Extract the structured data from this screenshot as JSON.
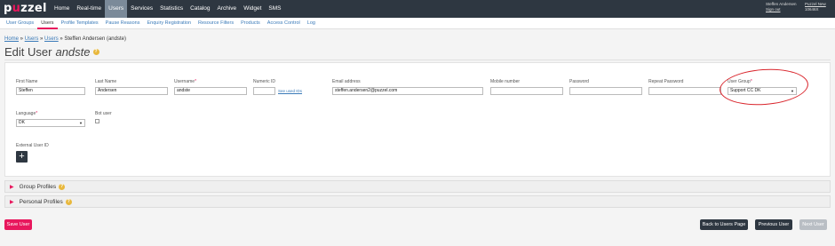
{
  "brand": {
    "logo": "puzzel"
  },
  "nav": [
    "Home",
    "Real-time",
    "Users",
    "Services",
    "Statistics",
    "Catalog",
    "Archive",
    "Widget",
    "SMS"
  ],
  "user_info": {
    "name": "Steffen Andersen",
    "sign_out": "Sign out",
    "company": "Puzzel New",
    "customer_id": "10646X"
  },
  "subnav": [
    "User Groups",
    "Users",
    "Profile Templates",
    "Pause Reasons",
    "Enquiry Registration",
    "Resource Filters",
    "Products",
    "Access Control",
    "Log"
  ],
  "breadcrumb": {
    "home": "Home",
    "users1": "Users",
    "users2": "Users",
    "current": "Steffen Andersen (andste)"
  },
  "title": {
    "prefix": "Edit User",
    "username": "andste"
  },
  "form": {
    "first_name": {
      "label": "First Name",
      "value": "Steffen"
    },
    "last_name": {
      "label": "Last Name",
      "value": "Andersen"
    },
    "username": {
      "label": "Username",
      "value": "andste"
    },
    "numeric_id": {
      "label": "Numeric ID",
      "value": "",
      "link": "See used IDs"
    },
    "email": {
      "label": "Email address",
      "value": "steffen.andersen2@puzzel.com"
    },
    "mobile": {
      "label": "Mobile number",
      "value": ""
    },
    "password": {
      "label": "Password",
      "value": ""
    },
    "repeat_password": {
      "label": "Repeat Password",
      "value": ""
    },
    "user_group": {
      "label": "User Group",
      "value": "Support CC DK"
    },
    "language": {
      "label": "Language",
      "value": "DK"
    },
    "bot_user": {
      "label": "Bot user"
    },
    "external_user_id": {
      "label": "External User ID"
    },
    "required_mark": "*",
    "add_symbol": "+"
  },
  "sections": {
    "group_profiles": "Group Profiles",
    "personal_profiles": "Personal Profiles"
  },
  "buttons": {
    "save": "Save User",
    "back": "Back to Users Page",
    "previous": "Previous User",
    "next": "Next User"
  },
  "colors": {
    "accent": "#e8175d",
    "dark": "#2e3741",
    "link": "#3a7ab8",
    "annotation": "#d9232a"
  }
}
